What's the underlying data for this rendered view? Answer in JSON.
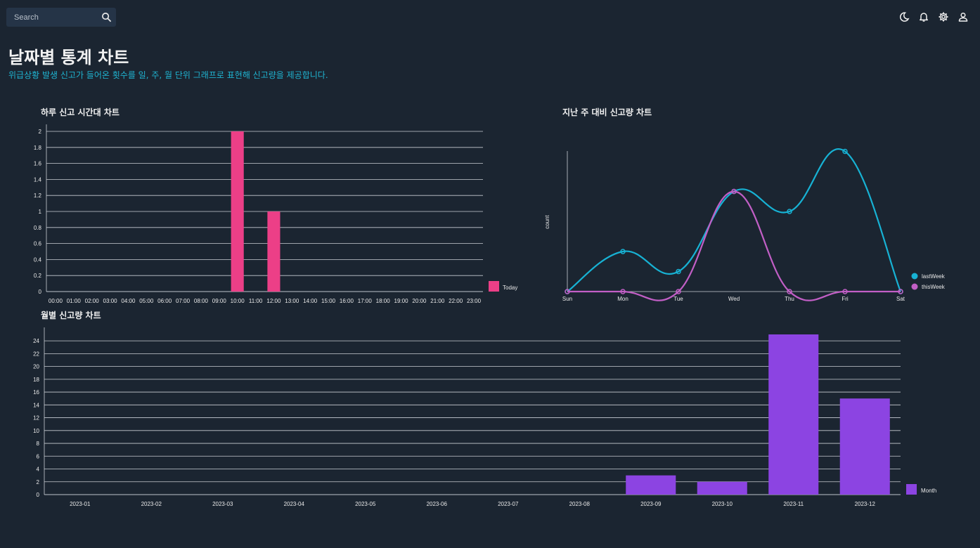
{
  "search": {
    "placeholder": "Search"
  },
  "header_icons": [
    "moon-icon",
    "bell-icon",
    "gear-icon",
    "user-icon"
  ],
  "page": {
    "title": "날짜별 통계 차트",
    "subtitle": "위급상황 발생 신고가 들어온 횟수를 일, 주, 월 단위 그래프로 표현해 신고량을 제공합니다."
  },
  "colors": {
    "background": "#1b2531",
    "hourly_bar": "#ec3f87",
    "last_week": "#17b2d4",
    "this_week": "#c25fc6",
    "month_bar": "#8c44e2",
    "accent": "#1fb2cf"
  },
  "chart_data": [
    {
      "id": "hourly",
      "type": "bar",
      "title": "하루 신고 시간대 차트",
      "categories": [
        "00:00",
        "01:00",
        "02:00",
        "03:00",
        "04:00",
        "05:00",
        "06:00",
        "07:00",
        "08:00",
        "09:00",
        "10:00",
        "11:00",
        "12:00",
        "13:00",
        "14:00",
        "15:00",
        "16:00",
        "17:00",
        "18:00",
        "19:00",
        "20:00",
        "21:00",
        "22:00",
        "23:00"
      ],
      "series": [
        {
          "name": "Today",
          "values": [
            0,
            0,
            0,
            0,
            0,
            0,
            0,
            0,
            0,
            0,
            2,
            0,
            1,
            0,
            0,
            0,
            0,
            0,
            0,
            0,
            0,
            0,
            0,
            0
          ]
        }
      ],
      "ylim": [
        0,
        2
      ],
      "yticks": [
        "0",
        "0.2",
        "0.4",
        "0.6",
        "0.8",
        "1",
        "1.2",
        "1.4",
        "1.6",
        "1.8",
        "2"
      ],
      "grid": true,
      "legend": "right-bottom"
    },
    {
      "id": "weekly",
      "type": "line",
      "title": "지난 주 대비 신고량 차트",
      "categories": [
        "Sun",
        "Mon",
        "Tue",
        "Wed",
        "Thu",
        "Fri",
        "Sat"
      ],
      "ylabel": "count",
      "series": [
        {
          "name": "lastWeek",
          "values": [
            0,
            2,
            1,
            5,
            4,
            7,
            0
          ]
        },
        {
          "name": "thisWeek",
          "values": [
            0,
            0,
            0,
            5,
            0,
            0,
            0
          ]
        }
      ],
      "ylim": [
        0,
        8
      ],
      "grid": false,
      "legend": "right-bottom"
    },
    {
      "id": "monthly",
      "type": "bar",
      "title": "월별 신고량 차트",
      "categories": [
        "2023-01",
        "2023-02",
        "2023-03",
        "2023-04",
        "2023-05",
        "2023-06",
        "2023-07",
        "2023-08",
        "2023-09",
        "2023-10",
        "2023-11",
        "2023-12"
      ],
      "series": [
        {
          "name": "Month",
          "values": [
            0,
            0,
            0,
            0,
            0,
            0,
            0,
            0,
            3,
            2,
            25,
            15
          ]
        }
      ],
      "ylim": [
        0,
        25
      ],
      "yticks": [
        "0",
        "2",
        "4",
        "6",
        "8",
        "10",
        "12",
        "14",
        "16",
        "18",
        "20",
        "22",
        "24"
      ],
      "grid": true,
      "legend": "right-bottom"
    }
  ]
}
